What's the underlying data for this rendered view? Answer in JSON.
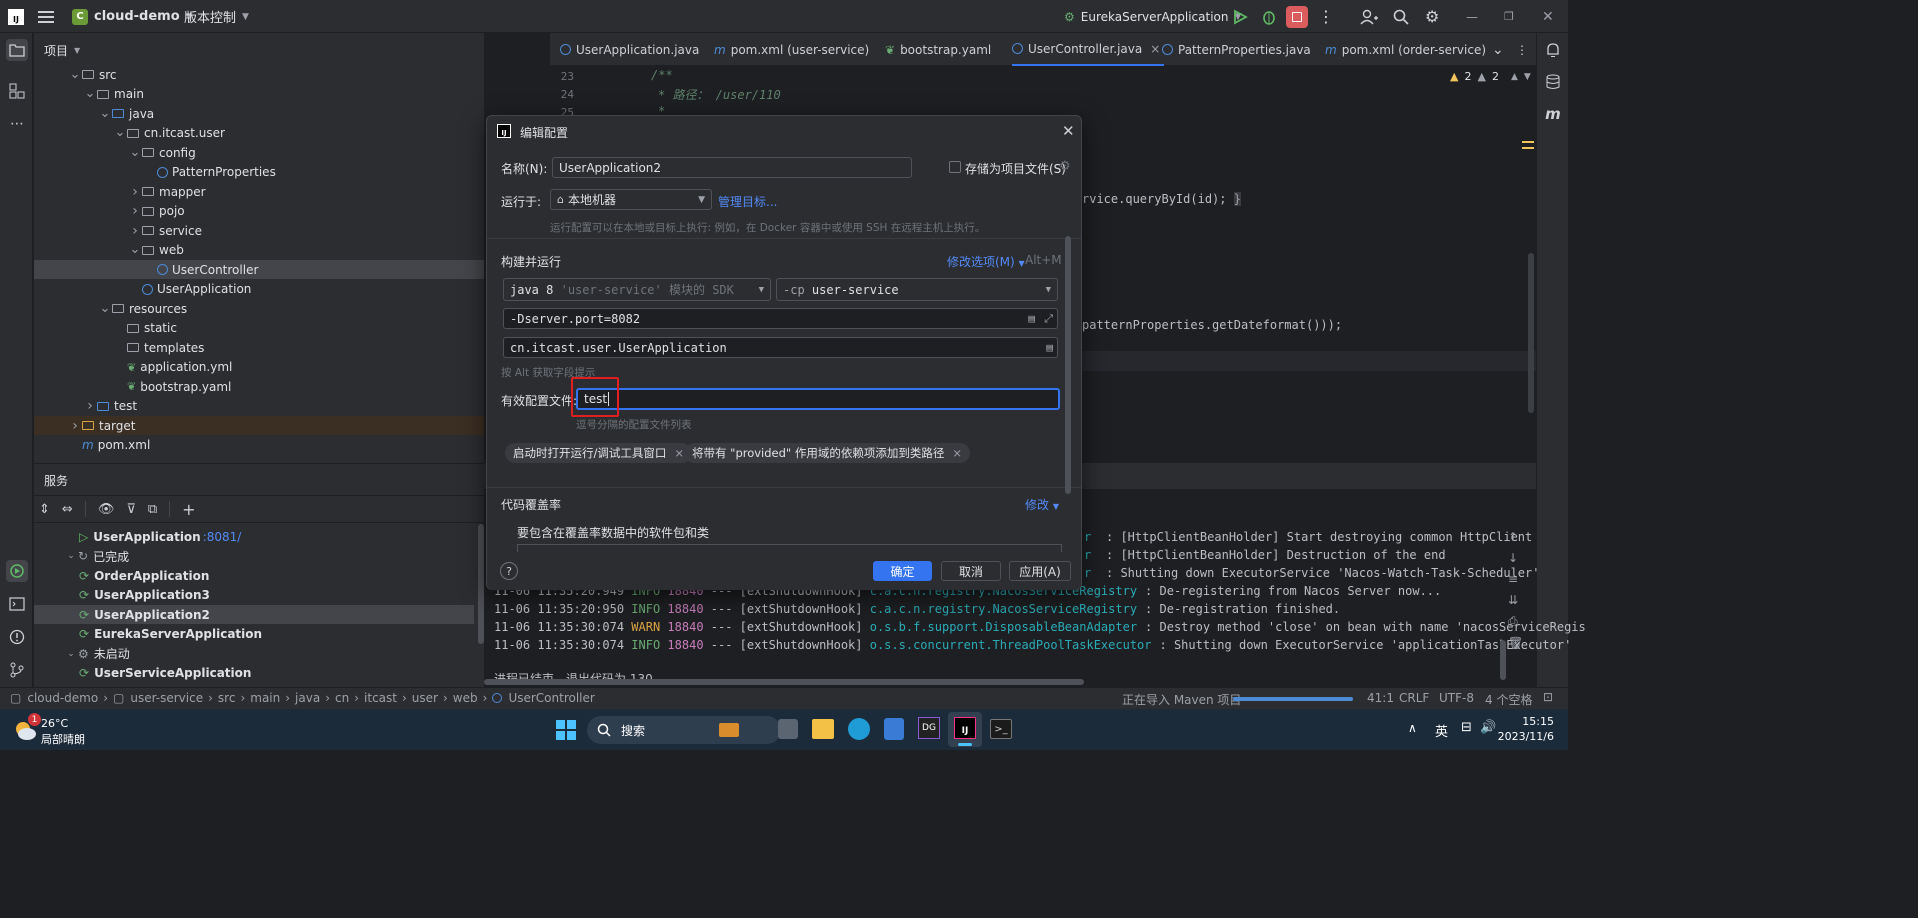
{
  "titlebar": {
    "project_badge": "C",
    "project_name": "cloud-demo",
    "vcs": "版本控制",
    "run_config": "EurekaServerApplication"
  },
  "project_panel": {
    "title": "项目",
    "tree": [
      {
        "label": "src",
        "indent": 2,
        "type": "folder",
        "open": true
      },
      {
        "label": "main",
        "indent": 3,
        "type": "folder",
        "open": true
      },
      {
        "label": "java",
        "indent": 4,
        "type": "folder",
        "open": true
      },
      {
        "label": "cn.itcast.user",
        "indent": 5,
        "type": "folder",
        "open": true
      },
      {
        "label": "config",
        "indent": 6,
        "type": "folder",
        "open": true
      },
      {
        "label": "PatternProperties",
        "indent": 7,
        "type": "class"
      },
      {
        "label": "mapper",
        "indent": 6,
        "type": "folder",
        "open": false
      },
      {
        "label": "pojo",
        "indent": 6,
        "type": "folder",
        "open": false
      },
      {
        "label": "service",
        "indent": 6,
        "type": "folder",
        "open": false
      },
      {
        "label": "web",
        "indent": 6,
        "type": "folder",
        "open": true
      },
      {
        "label": "UserController",
        "indent": 7,
        "type": "class",
        "selected": true
      },
      {
        "label": "UserApplication",
        "indent": 6,
        "type": "class"
      },
      {
        "label": "resources",
        "indent": 4,
        "type": "folder",
        "open": true
      },
      {
        "label": "static",
        "indent": 5,
        "type": "folder"
      },
      {
        "label": "templates",
        "indent": 5,
        "type": "folder"
      },
      {
        "label": "application.yml",
        "indent": 5,
        "type": "yaml"
      },
      {
        "label": "bootstrap.yaml",
        "indent": 5,
        "type": "yaml"
      },
      {
        "label": "test",
        "indent": 3,
        "type": "folder",
        "open": false
      },
      {
        "label": "target",
        "indent": 2,
        "type": "folder",
        "open": false,
        "highlight": true
      },
      {
        "label": "pom.xml",
        "indent": 2,
        "type": "maven"
      }
    ]
  },
  "services_panel": {
    "title": "服务",
    "items": [
      {
        "label": "UserApplication",
        "suffix": ":8081/",
        "indent": 2,
        "type": "running"
      },
      {
        "label": "已完成",
        "indent": 1,
        "type": "group"
      },
      {
        "label": "OrderApplication",
        "indent": 2,
        "type": "app"
      },
      {
        "label": "UserApplication3",
        "indent": 2,
        "type": "app"
      },
      {
        "label": "UserApplication2",
        "indent": 2,
        "type": "app",
        "selected": true
      },
      {
        "label": "EurekaServerApplication",
        "indent": 2,
        "type": "app"
      },
      {
        "label": "未启动",
        "indent": 1,
        "type": "group"
      },
      {
        "label": "UserServiceApplication",
        "indent": 2,
        "type": "app"
      }
    ]
  },
  "editor_tabs": [
    {
      "label": "UserApplication.java"
    },
    {
      "label": "pom.xml (user-service)"
    },
    {
      "label": "bootstrap.yaml"
    },
    {
      "label": "UserController.java",
      "active": true
    },
    {
      "label": "PatternProperties.java"
    },
    {
      "label": "pom.xml (order-service)"
    }
  ],
  "editor": {
    "lines": [
      {
        "n": "23",
        "text": "/**"
      },
      {
        "n": "24",
        "text": "* 路径： /user/110"
      },
      {
        "n": "25",
        "text": "*"
      }
    ],
    "fragment1": "rvice.queryById(id);",
    "fragment2": "patternProperties.getDateformat()));",
    "warn1": "2",
    "warn2": "2"
  },
  "dialog": {
    "title": "编辑配置",
    "name_label": "名称(N):",
    "name_value": "UserApplication2",
    "store_label": "存储为项目文件(S)",
    "run_on_label": "运行于:",
    "run_on_value": "本地机器",
    "manage_targets": "管理目标...",
    "run_hint": "运行配置可以在本地或目标上执行: 例如，在 Docker 容器中或使用 SSH 在远程主机上执行。",
    "build_run": "构建并运行",
    "modify_options": "修改选项(M)",
    "modify_shortcut": "Alt+M",
    "sdk_value": "java 8",
    "sdk_hint": "'user-service' 模块的 SDK",
    "cp_flag": "-cp",
    "cp_value": "user-service",
    "vm_options": "-Dserver.port=8082",
    "main_class": "cn.itcast.user.UserApplication",
    "alt_hint": "按 Alt 获取字段提示",
    "profiles_label": "有效配置文件:",
    "profiles_value": "test",
    "profiles_hint": "逗号分隔的配置文件列表",
    "chip1": "启动时打开运行/调试工具窗口",
    "chip2": "将带有 \"provided\" 作用域的依赖项添加到类路径",
    "coverage_title": "代码覆盖率",
    "coverage_modify": "修改",
    "coverage_sub": "要包含在覆盖率数据中的软件包和类",
    "ok": "确定",
    "cancel": "取消",
    "apply": "应用(A)"
  },
  "console": {
    "lines": [
      {
        "time": "",
        "level": "",
        "pid": "",
        "thread": "",
        "logger": "r",
        "msg": ": [HttpClientBeanHolder] Start destroying common HttpClient"
      },
      {
        "time": "",
        "level": "",
        "pid": "",
        "thread": "",
        "logger": "r",
        "msg": ": [HttpClientBeanHolder] Destruction of the end"
      },
      {
        "time": "",
        "level": "",
        "pid": "",
        "thread": "",
        "logger": "r",
        "msg": ": Shutting down ExecutorService 'Nacos-Watch-Task-Scheduler'"
      },
      {
        "time": "11-06 11:35:20.949",
        "level": "INFO",
        "pid": "18840",
        "thread": "--- [extShutdownHook]",
        "logger": "c.a.c.n.registry.NacosServiceRegistry",
        "msg": ": De-registering from Nacos Server now..."
      },
      {
        "time": "11-06 11:35:20:950",
        "level": "INFO",
        "pid": "18840",
        "thread": "--- [extShutdownHook]",
        "logger": "c.a.c.n.registry.NacosServiceRegistry",
        "msg": ": De-registration finished."
      },
      {
        "time": "11-06 11:35:30:074",
        "level": "WARN",
        "pid": "18840",
        "thread": "--- [extShutdownHook]",
        "logger": "o.s.b.f.support.DisposableBeanAdapter",
        "msg": ": Destroy method 'close' on bean with name 'nacosServiceRegis"
      },
      {
        "time": "11-06 11:35:30:074",
        "level": "INFO",
        "pid": "18840",
        "thread": "--- [extShutdownHook]",
        "logger": "o.s.s.concurrent.ThreadPoolTaskExecutor",
        "msg": ": Shutting down ExecutorService 'applicationTaskExecutor'"
      }
    ],
    "exit": "进程已结束，退出代码为 130"
  },
  "statusbar": {
    "crumbs": [
      "cloud-demo",
      "user-service",
      "src",
      "main",
      "java",
      "cn",
      "itcast",
      "user",
      "web",
      "UserController"
    ],
    "task": "正在导入 Maven 项目",
    "pos": "41:1",
    "eol": "CRLF",
    "enc": "UTF-8",
    "indent": "4 个空格"
  },
  "taskbar": {
    "temp": "26°C",
    "weather": "局部晴朗",
    "badge": "1",
    "search": "搜索",
    "ime": "英",
    "time": "15:15",
    "date": "2023/11/6"
  }
}
